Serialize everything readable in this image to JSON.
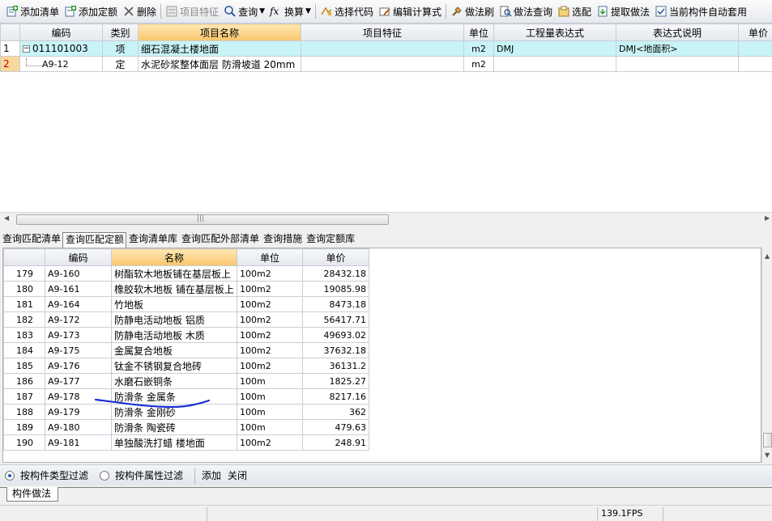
{
  "toolbar": {
    "buttons": [
      {
        "label": "添加清单",
        "icon": "add-list-icon"
      },
      {
        "label": "添加定额",
        "icon": "add-quota-icon"
      },
      {
        "label": "删除",
        "icon": "delete-icon"
      },
      {
        "label": "项目特征",
        "icon": "feature-icon"
      },
      {
        "label": "查询",
        "icon": "search-icon"
      },
      {
        "label": "换算",
        "icon": "fx-icon"
      },
      {
        "label": "选择代码",
        "icon": "select-code-icon"
      },
      {
        "label": "编辑计算式",
        "icon": "edit-formula-icon"
      },
      {
        "label": "做法刷",
        "icon": "brush-icon"
      },
      {
        "label": "做法查询",
        "icon": "method-query-icon"
      },
      {
        "label": "选配",
        "icon": "match-icon"
      },
      {
        "label": "提取做法",
        "icon": "extract-icon"
      },
      {
        "label": "当前构件自动套用",
        "icon": "auto-apply-icon"
      }
    ]
  },
  "upper_table": {
    "columns": [
      "编码",
      "类别",
      "项目名称",
      "项目特征",
      "单位",
      "工程量表达式",
      "表达式说明",
      "单价"
    ],
    "rows": [
      {
        "idx": "1",
        "code": "011101003",
        "type": "项",
        "name": "细石混凝土楼地面",
        "feature": "",
        "unit": "m2",
        "expr": "DMJ",
        "desc": "DMJ<地面积>",
        "price": ""
      },
      {
        "idx": "2",
        "code": "A9-12",
        "type": "定",
        "name": "水泥砂浆整体面层 防滑坡道 20mm",
        "feature": "",
        "unit": "m2",
        "expr": "",
        "desc": "",
        "price": ""
      }
    ],
    "scroll_mark": "|||"
  },
  "query_tabs": [
    "查询匹配清单",
    "查询匹配定额",
    "查询清单库",
    "查询匹配外部清单",
    "查询措施",
    "查询定额库"
  ],
  "lower_table": {
    "columns": [
      "编码",
      "名称",
      "单位",
      "单价"
    ],
    "rows": [
      {
        "idx": "179",
        "code": "A9-160",
        "name": "树酯软木地板铺在基层板上",
        "unit": "100m2",
        "price": "28432.18"
      },
      {
        "idx": "180",
        "code": "A9-161",
        "name": "橡胶软木地板 铺在基层板上",
        "unit": "100m2",
        "price": "19085.98"
      },
      {
        "idx": "181",
        "code": "A9-164",
        "name": "竹地板",
        "unit": "100m2",
        "price": "8473.18"
      },
      {
        "idx": "182",
        "code": "A9-172",
        "name": "防静电活动地板 铝质",
        "unit": "100m2",
        "price": "56417.71"
      },
      {
        "idx": "183",
        "code": "A9-173",
        "name": "防静电活动地板 木质",
        "unit": "100m2",
        "price": "49693.02"
      },
      {
        "idx": "184",
        "code": "A9-175",
        "name": "金属复合地板",
        "unit": "100m2",
        "price": "37632.18"
      },
      {
        "idx": "185",
        "code": "A9-176",
        "name": "钛金不锈钢复合地砖",
        "unit": "100m2",
        "price": "36131.2"
      },
      {
        "idx": "186",
        "code": "A9-177",
        "name": "水磨石嵌铜条",
        "unit": "100m",
        "price": "1825.27"
      },
      {
        "idx": "187",
        "code": "A9-178",
        "name": "防滑条 金属条",
        "unit": "100m",
        "price": "8217.16"
      },
      {
        "idx": "188",
        "code": "A9-179",
        "name": "防滑条 金刚砂",
        "unit": "100m",
        "price": "362"
      },
      {
        "idx": "189",
        "code": "A9-180",
        "name": "防滑条 陶瓷砖",
        "unit": "100m",
        "price": "479.63"
      },
      {
        "idx": "190",
        "code": "A9-181",
        "name": "单独酸洗打蜡 楼地面",
        "unit": "100m2",
        "price": "248.91"
      }
    ]
  },
  "filter_bar": {
    "options": [
      "按构件类型过滤",
      "按构件属性过滤"
    ],
    "selected": "按构件类型过滤",
    "add_label": "添加",
    "close_label": "关闭"
  },
  "bottom_tab": "构件做法",
  "status": {
    "fps": "139.1FPS"
  },
  "colors": {
    "selected_row": "#c9f4f7",
    "header_highlight": "#f8c66b",
    "annotation": "#1a2fd4"
  }
}
